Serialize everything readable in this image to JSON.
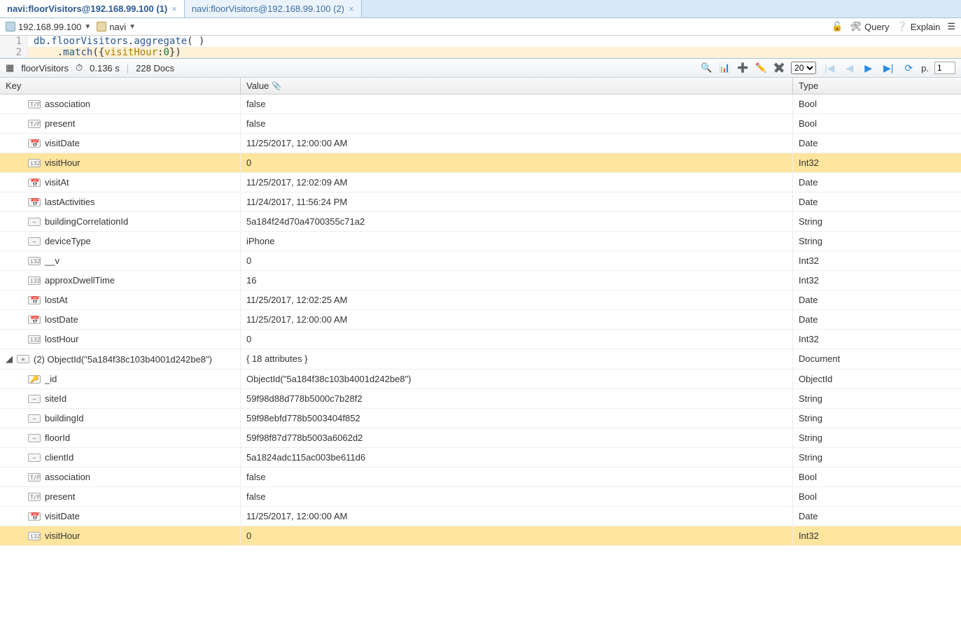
{
  "tabs": [
    {
      "label": "navi:floorVisitors@192.168.99.100 (1)",
      "active": true
    },
    {
      "label": "navi:floorVisitors@192.168.99.100 (2)",
      "active": false
    }
  ],
  "connection": {
    "host": "192.168.99.100",
    "db": "navi"
  },
  "toolbar": {
    "query_label": "Query",
    "explain_label": "Explain"
  },
  "code": {
    "line1_num": "1",
    "line2_num": "2",
    "line1_db": "db",
    "line1_coll": "floorVisitors",
    "line1_method": "aggregate",
    "line2_method": "match",
    "line2_field": "visitHour",
    "line2_value": "0"
  },
  "status": {
    "collection": "floorVisitors",
    "time": "0.136 s",
    "docs": "228 Docs",
    "page_size": "20",
    "page_label": "p.",
    "page_value": "1"
  },
  "headers": {
    "key": "Key",
    "value": "Value",
    "type": "Type"
  },
  "rows": [
    {
      "indent": "child",
      "icon": "ico-bool",
      "key": "association",
      "value": "false",
      "type": "Bool",
      "hl": false
    },
    {
      "indent": "child",
      "icon": "ico-bool",
      "key": "present",
      "value": "false",
      "type": "Bool",
      "hl": false
    },
    {
      "indent": "child",
      "icon": "ico-date",
      "key": "visitDate",
      "value": "11/25/2017, 12:00:00 AM",
      "type": "Date",
      "hl": false
    },
    {
      "indent": "child",
      "icon": "ico-int",
      "key": "visitHour",
      "value": "0",
      "type": "Int32",
      "hl": true
    },
    {
      "indent": "child",
      "icon": "ico-date",
      "key": "visitAt",
      "value": "11/25/2017, 12:02:09 AM",
      "type": "Date",
      "hl": false
    },
    {
      "indent": "child",
      "icon": "ico-date",
      "key": "lastActivities",
      "value": "11/24/2017, 11:56:24 PM",
      "type": "Date",
      "hl": false
    },
    {
      "indent": "child",
      "icon": "ico-str",
      "key": "buildingCorrelationId",
      "value": "5a184f24d70a4700355c71a2",
      "type": "String",
      "hl": false
    },
    {
      "indent": "child",
      "icon": "ico-str",
      "key": "deviceType",
      "value": "iPhone",
      "type": "String",
      "hl": false
    },
    {
      "indent": "child",
      "icon": "ico-int",
      "key": "__v",
      "value": "0",
      "type": "Int32",
      "hl": false
    },
    {
      "indent": "child",
      "icon": "ico-int",
      "key": "approxDwellTime",
      "value": "16",
      "type": "Int32",
      "hl": false
    },
    {
      "indent": "child",
      "icon": "ico-date",
      "key": "lostAt",
      "value": "11/25/2017, 12:02:25 AM",
      "type": "Date",
      "hl": false
    },
    {
      "indent": "child",
      "icon": "ico-date",
      "key": "lostDate",
      "value": "11/25/2017, 12:00:00 AM",
      "type": "Date",
      "hl": false
    },
    {
      "indent": "child",
      "icon": "ico-int",
      "key": "lostHour",
      "value": "0",
      "type": "Int32",
      "hl": false
    },
    {
      "indent": "doc",
      "icon": "ico-doc",
      "key": "(2) ObjectId(\"5a184f38c103b4001d242be8\")",
      "value": "{ 18 attributes }",
      "type": "Document",
      "hl": false
    },
    {
      "indent": "child",
      "icon": "ico-oid",
      "key": "_id",
      "value": "ObjectId(\"5a184f38c103b4001d242be8\")",
      "type": "ObjectId",
      "hl": false
    },
    {
      "indent": "child",
      "icon": "ico-str",
      "key": "siteId",
      "value": "59f98d88d778b5000c7b28f2",
      "type": "String",
      "hl": false
    },
    {
      "indent": "child",
      "icon": "ico-str",
      "key": "buildingId",
      "value": "59f98ebfd778b5003404f852",
      "type": "String",
      "hl": false
    },
    {
      "indent": "child",
      "icon": "ico-str",
      "key": "floorId",
      "value": "59f98f87d778b5003a6062d2",
      "type": "String",
      "hl": false
    },
    {
      "indent": "child",
      "icon": "ico-str",
      "key": "clientId",
      "value": "5a1824adc115ac003be611d6",
      "type": "String",
      "hl": false
    },
    {
      "indent": "child",
      "icon": "ico-bool",
      "key": "association",
      "value": "false",
      "type": "Bool",
      "hl": false
    },
    {
      "indent": "child",
      "icon": "ico-bool",
      "key": "present",
      "value": "false",
      "type": "Bool",
      "hl": false
    },
    {
      "indent": "child",
      "icon": "ico-date",
      "key": "visitDate",
      "value": "11/25/2017, 12:00:00 AM",
      "type": "Date",
      "hl": false
    },
    {
      "indent": "child",
      "icon": "ico-int",
      "key": "visitHour",
      "value": "0",
      "type": "Int32",
      "hl": true
    }
  ]
}
